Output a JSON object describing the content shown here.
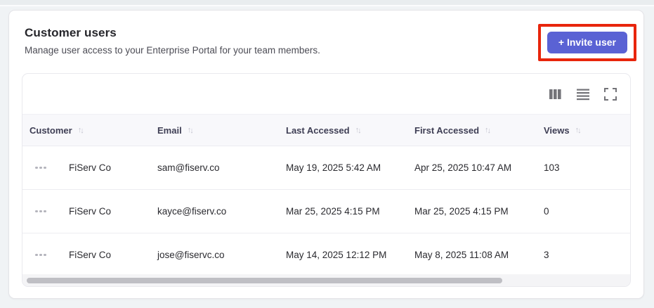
{
  "page": {
    "title": "Customer users",
    "subtitle": "Manage user access to your Enterprise Portal for your team members.",
    "invite_button_label": "+ Invite user"
  },
  "toolbar": {
    "icons": [
      "columns-icon",
      "density-icon",
      "fullscreen-icon"
    ]
  },
  "table": {
    "columns": [
      "Customer",
      "Email",
      "Last Accessed",
      "First Accessed",
      "Views"
    ],
    "sort_icon": "sort-arrows-icon",
    "row_menu_icon": "meatball-menu-icon",
    "rows": [
      {
        "customer": "FiServ Co",
        "email": "sam@fiserv.co",
        "last_accessed": "May 19, 2025 5:42 AM",
        "first_accessed": "Apr 25, 2025 10:47 AM",
        "views": "103"
      },
      {
        "customer": "FiServ Co",
        "email": "kayce@fiserv.co",
        "last_accessed": "Mar 25, 2025 4:15 PM",
        "first_accessed": "Mar 25, 2025 4:15 PM",
        "views": "0"
      },
      {
        "customer": "FiServ Co",
        "email": "jose@fiservc.co",
        "last_accessed": "May 14, 2025 12:12 PM",
        "first_accessed": "May 8, 2025 11:08 AM",
        "views": "3"
      }
    ]
  },
  "colors": {
    "accent": "#5a62d4",
    "annotation_highlight": "#e8250c",
    "header_bg": "#f8f8fb"
  }
}
